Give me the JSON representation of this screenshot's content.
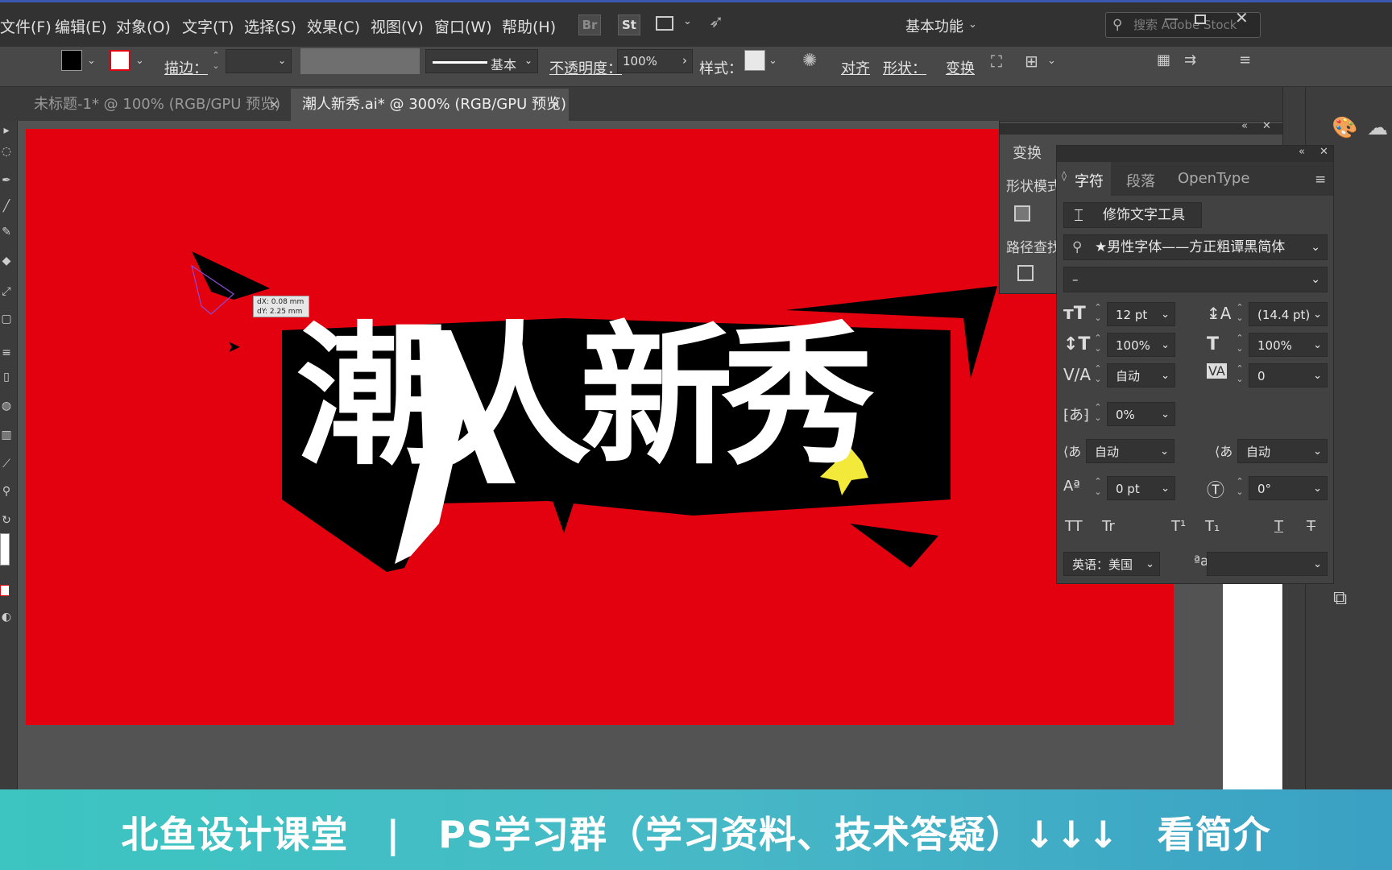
{
  "menu": [
    "文件(F)",
    "编辑(E)",
    "对象(O)",
    "文字(T)",
    "选择(S)",
    "效果(C)",
    "视图(V)",
    "窗口(W)",
    "帮助(H)"
  ],
  "menubar_icons": {
    "bridge": "Br",
    "stock": "St"
  },
  "workspace": "基本功能",
  "search_placeholder": "搜索 Adobe Stock",
  "control": {
    "stroke_label": "描边：",
    "stroke_style": "基本",
    "opacity_label": "不透明度：",
    "opacity_value": "100%",
    "style_label": "样式：",
    "align_label": "对齐",
    "shape_label": "形状：",
    "transform_label": "变换"
  },
  "tabs": [
    {
      "label": "未标题-1* @ 100% (RGB/GPU 预览)"
    },
    {
      "label": "潮人新秀.ai* @ 300% (RGB/GPU 预览)"
    }
  ],
  "artwork": {
    "title": "潮人新秀"
  },
  "tooltip": {
    "dx": "dX: 0.08 mm",
    "dy": "dY: 2.25 mm"
  },
  "back_panel": {
    "tab": "变换",
    "shape_modes": "形状模式",
    "pathfinder": "路径查找器"
  },
  "char_panel": {
    "tabs": [
      "字符",
      "段落",
      "OpenType"
    ],
    "touch_type": "修饰文字工具",
    "font_family": "★男性字体——方正粗谭黑简体",
    "font_style": "–",
    "font_size": "12 pt",
    "leading": "(14.4 pt)",
    "vscale": "100%",
    "hscale": "100%",
    "kerning": "自动",
    "tracking": "0",
    "tsume": "0%",
    "aki_left": "自动",
    "aki_right": "自动",
    "baseline": "0 pt",
    "rotation": "0°",
    "style_buttons": [
      "TT",
      "Tr",
      "T¹",
      "T₁",
      "T",
      "T"
    ],
    "language": "英语：美国",
    "aa_icon": "ªa"
  },
  "banner": "北鱼设计课堂　|　PS学习群（学习资料、技术答疑）↓↓↓　看简介",
  "colors": {
    "artboard": "#e3000f",
    "star": "#f2e93b",
    "banner": "#3cc5c1"
  }
}
